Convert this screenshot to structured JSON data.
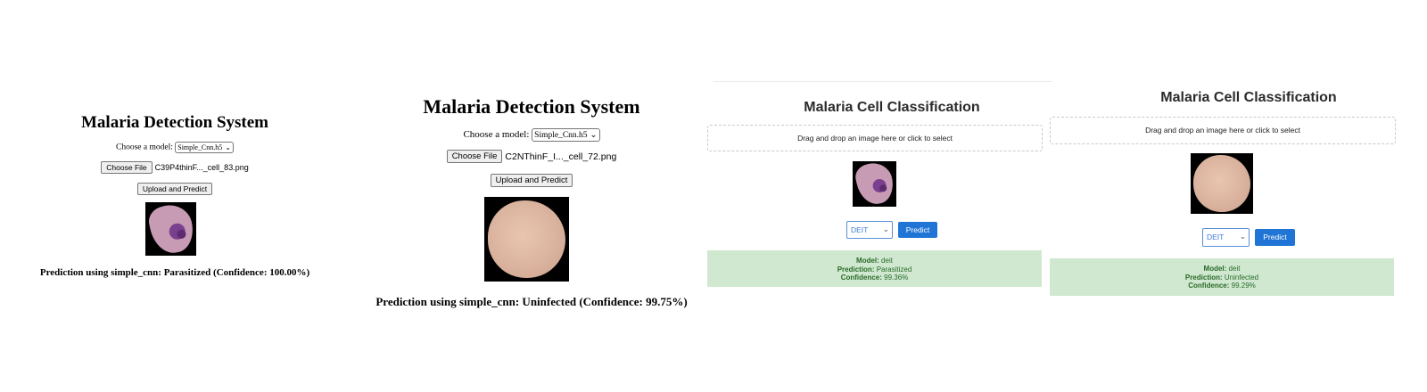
{
  "panels": [
    {
      "title": "Malaria Detection System",
      "model_label": "Choose a model:",
      "model_selected": "Simple_Cnn.h5",
      "choose_file_label": "Choose File",
      "file_name": "C39P4thinF..._cell_83.png",
      "upload_label": "Upload and Predict",
      "image_class": "parasitized-cell",
      "prediction_text": "Prediction using simple_cnn: Parasitized (Confidence: 100.00%)"
    },
    {
      "title": "Malaria Detection System",
      "model_label": "Choose a model:",
      "model_selected": "Simple_Cnn.h5",
      "choose_file_label": "Choose File",
      "file_name": "C2NThinF_I..._cell_72.png",
      "upload_label": "Upload and Predict",
      "image_class": "uninfected-cell",
      "prediction_text": "Prediction using simple_cnn: Uninfected (Confidence: 99.75%)"
    },
    {
      "title": "Malaria Cell Classification",
      "dropzone_text": "Drag and drop an image here or click to select",
      "image_class": "parasitized-cell",
      "model_selected": "DEIT",
      "predict_label": "Predict",
      "result": {
        "model_label": "Model:",
        "model_value": "deit",
        "prediction_label": "Prediction:",
        "prediction_value": "Parasitized",
        "confidence_label": "Confidence:",
        "confidence_value": "99.36%"
      }
    },
    {
      "title": "Malaria Cell Classification",
      "dropzone_text": "Drag and drop an image here or click to select",
      "image_class": "uninfected-cell",
      "model_selected": "DEIT",
      "predict_label": "Predict",
      "result": {
        "model_label": "Model:",
        "model_value": "deit",
        "prediction_label": "Prediction:",
        "prediction_value": "Uninfected",
        "confidence_label": "Confidence:",
        "confidence_value": "99.29%"
      }
    }
  ],
  "colors": {
    "predict_button": "#1f74d6",
    "result_background": "#cfe8cf",
    "result_text": "#2a6a2a",
    "select_accent": "#3a7bd5"
  }
}
